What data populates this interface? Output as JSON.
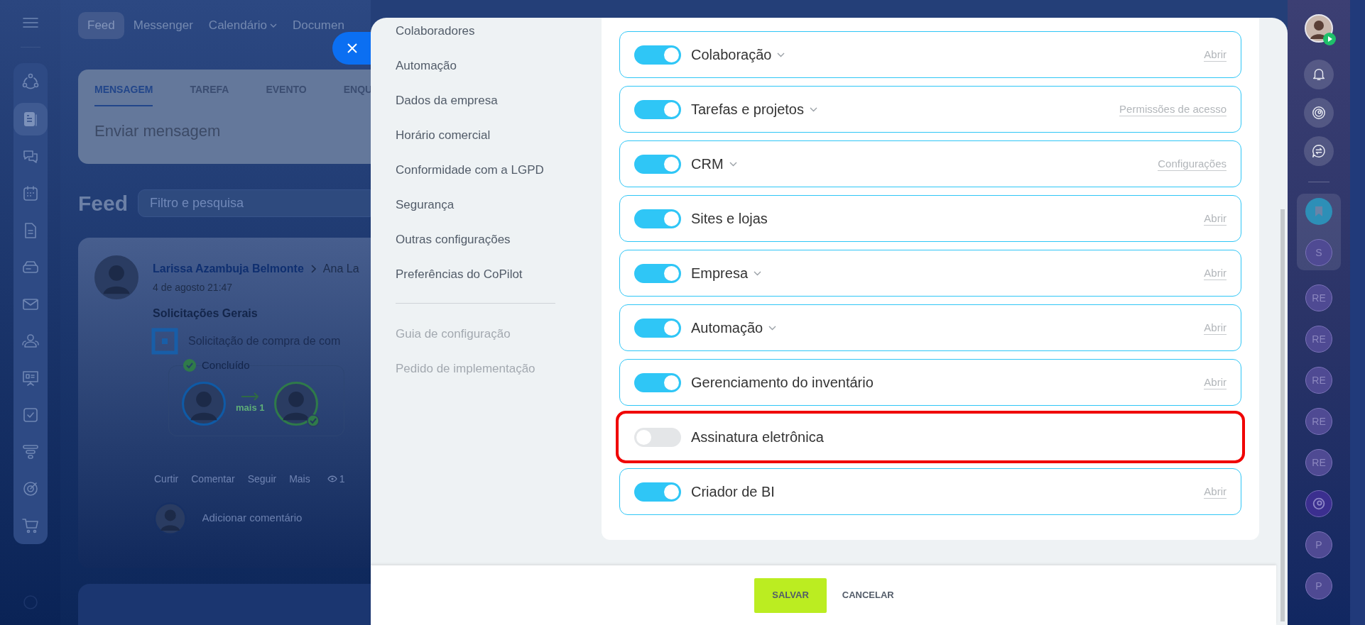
{
  "top_nav": {
    "tabs": [
      {
        "label": "Feed",
        "selected": true,
        "dropdown": false
      },
      {
        "label": "Messenger",
        "selected": false,
        "dropdown": false
      },
      {
        "label": "Calendário",
        "selected": false,
        "dropdown": true
      },
      {
        "label": "Documen",
        "selected": false,
        "dropdown": false
      }
    ]
  },
  "composer": {
    "tabs": [
      {
        "label": "MENSAGEM",
        "selected": true
      },
      {
        "label": "TAREFA",
        "selected": false
      },
      {
        "label": "EVENTO",
        "selected": false
      },
      {
        "label": "ENQU",
        "selected": false
      }
    ],
    "placeholder": "Enviar mensagem"
  },
  "feed": {
    "title": "Feed",
    "search_placeholder": "Filtro e pesquisa"
  },
  "post": {
    "author": "Larissa Azambuja Belmonte",
    "recipient": "Ana La",
    "date": "4 de agosto 21:47",
    "title": "Solicitações Gerais",
    "item": "Solicitação de compra de com",
    "status": "Concluído",
    "flow_label": "mais 1",
    "actions": [
      "Curtir",
      "Comentar",
      "Seguir",
      "Mais"
    ],
    "views": "1",
    "comment_placeholder": "Adicionar comentário"
  },
  "settings_menu": {
    "items": [
      "Colaboradores",
      "Automação",
      "Dados da empresa",
      "Horário comercial",
      "Conformidade com a LGPD",
      "Segurança",
      "Outras configurações",
      "Preferências do CoPilot"
    ],
    "links": [
      "Guia de configuração",
      "Pedido de implementação"
    ]
  },
  "tools": [
    {
      "name": "Colaboração",
      "on": true,
      "expandable": true,
      "link": "Abrir",
      "highlighted": false
    },
    {
      "name": "Tarefas e projetos",
      "on": true,
      "expandable": true,
      "link": "Permissões de acesso",
      "highlighted": false
    },
    {
      "name": "CRM",
      "on": true,
      "expandable": true,
      "link": "Configurações",
      "highlighted": false
    },
    {
      "name": "Sites e lojas",
      "on": true,
      "expandable": false,
      "link": "Abrir",
      "highlighted": false
    },
    {
      "name": "Empresa",
      "on": true,
      "expandable": true,
      "link": "Abrir",
      "highlighted": false
    },
    {
      "name": "Automação",
      "on": true,
      "expandable": true,
      "link": "Abrir",
      "highlighted": false
    },
    {
      "name": "Gerenciamento do inventário",
      "on": true,
      "expandable": false,
      "link": "Abrir",
      "highlighted": false
    },
    {
      "name": "Assinatura eletrônica",
      "on": false,
      "expandable": false,
      "highlighted": true
    },
    {
      "name": "Criador de BI",
      "on": true,
      "expandable": false,
      "link": "Abrir",
      "highlighted": false
    }
  ],
  "footer": {
    "buttons": [
      {
        "label": "SALVAR",
        "kind": "primary"
      },
      {
        "label": "CANCELAR",
        "kind": "link"
      }
    ]
  },
  "right_rail": {
    "chats": [
      {
        "kind": "bookmark"
      },
      {
        "kind": "initials",
        "label": "S"
      },
      {
        "kind": "initials",
        "label": "RE"
      },
      {
        "kind": "initials",
        "label": "RE"
      },
      {
        "kind": "initials",
        "label": "RE"
      },
      {
        "kind": "initials",
        "label": "RE"
      },
      {
        "kind": "initials",
        "label": "RE"
      },
      {
        "kind": "copilot"
      },
      {
        "kind": "initials",
        "label": "P"
      },
      {
        "kind": "initials",
        "label": "P"
      }
    ]
  }
}
